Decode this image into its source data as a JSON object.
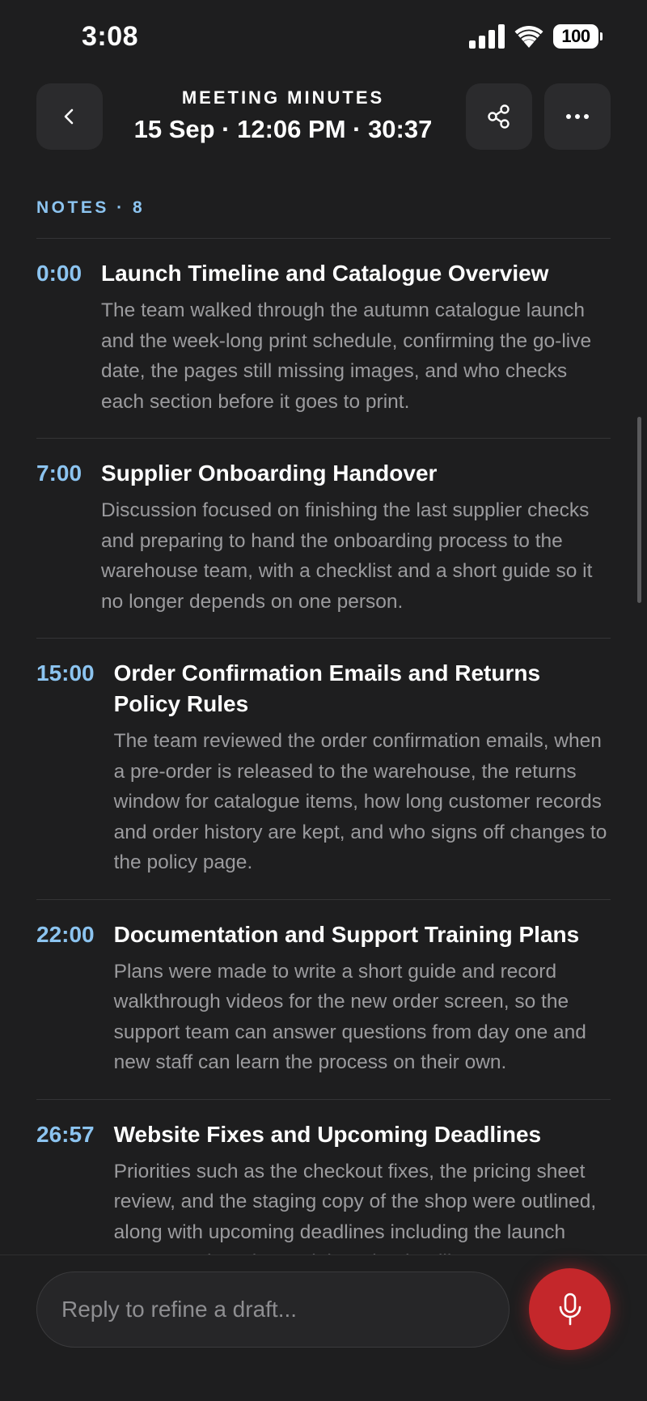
{
  "status_bar": {
    "time": "3:08",
    "battery": "100",
    "icons": [
      "cellular-signal-icon",
      "wifi-icon",
      "battery-icon"
    ]
  },
  "header": {
    "eyebrow": "MEETING MINUTES",
    "subtitle": "15 Sep · 12:06 PM · 30:37",
    "back_icon": "chevron-left-icon",
    "share_icon": "share-icon",
    "more_icon": "ellipsis-icon"
  },
  "notes_label": "NOTES · 8",
  "notes": [
    {
      "time": "0:00",
      "title": "Launch Timeline and Catalogue Overview",
      "text": "The team walked through the autumn catalogue launch and the week-long print schedule, confirming the go-live date, the pages still missing images, and who checks each section before it goes to print."
    },
    {
      "time": "7:00",
      "title": "Supplier Onboarding Handover",
      "text": "Discussion focused on finishing the last supplier checks and preparing to hand the onboarding process to the warehouse team, with a checklist and a short guide so it no longer depends on one person."
    },
    {
      "time": "15:00",
      "title": "Order Confirmation Emails and Returns Policy Rules",
      "text": "The team reviewed the order confirmation emails, when a pre-order is released to the warehouse, the returns window for catalogue items, how long customer records and order history are kept, and who signs off changes to the policy page."
    },
    {
      "time": "22:00",
      "title": "Documentation and Support Training Plans",
      "text": "Plans were made to write a short guide and record walkthrough videos for the new order screen, so the support team can answer questions from day one and new staff can learn the process on their own."
    },
    {
      "time": "26:57",
      "title": "Website Fixes and Upcoming Deadlines",
      "text": "Priorities such as the checkout fixes, the pricing sheet review, and the staging copy of the shop were outlined, along with upcoming deadlines including the launch event on Thursday and the print deadline"
    }
  ],
  "composer": {
    "placeholder": "Reply to refine a draft...",
    "mic_icon": "microphone-icon"
  },
  "colors": {
    "background": "#1e1e1f",
    "accent_timestamp": "#8cc4f0",
    "button_surface": "#2b2b2d",
    "mic_button": "#c4272b",
    "body_text": "#9b9b9e"
  }
}
